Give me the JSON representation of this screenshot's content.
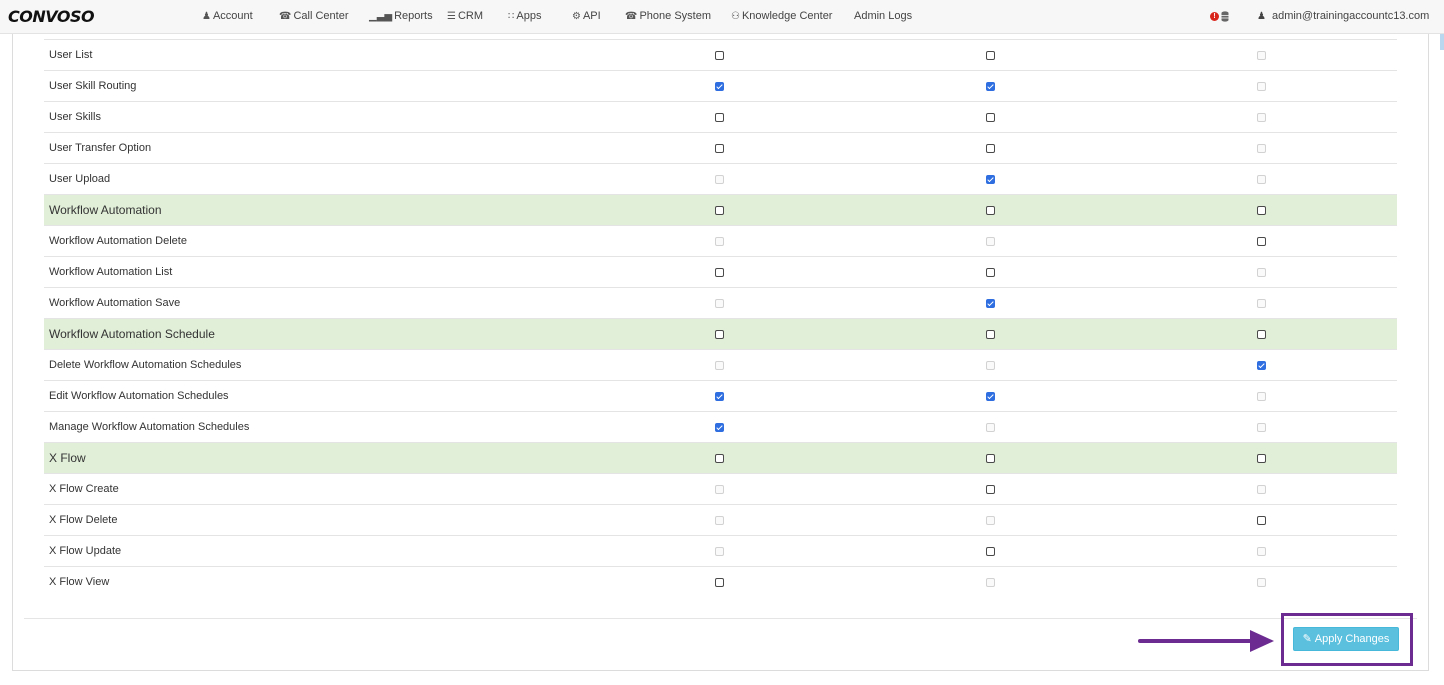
{
  "nav": {
    "logo": "CONVOSO",
    "items": [
      {
        "label": "Account",
        "icon": "user-icon",
        "glyph": "♟"
      },
      {
        "label": "Call Center",
        "icon": "phone-icon",
        "glyph": "☎"
      },
      {
        "label": "Reports",
        "icon": "bar-chart-icon",
        "glyph": "▁▃▅"
      },
      {
        "label": "CRM",
        "icon": "list-icon",
        "glyph": "☰"
      },
      {
        "label": "Apps",
        "icon": "grid-icon",
        "glyph": "∷"
      },
      {
        "label": "API",
        "icon": "gear-icon",
        "glyph": "⚙"
      },
      {
        "label": "Phone System",
        "icon": "phone-icon",
        "glyph": "☎"
      },
      {
        "label": "Knowledge Center",
        "icon": "lightbulb-icon",
        "glyph": "⚇"
      },
      {
        "label": "Admin Logs",
        "icon": "",
        "glyph": ""
      }
    ],
    "alert_glyph": "!",
    "user_email": "admin@trainingaccountc13.com",
    "user_glyph": "♟"
  },
  "rows": [
    {
      "label": "User List",
      "group": false,
      "cells": [
        "off",
        "off",
        "dis"
      ]
    },
    {
      "label": "User Skill Routing",
      "group": false,
      "cells": [
        "on",
        "on",
        "dis"
      ]
    },
    {
      "label": "User Skills",
      "group": false,
      "cells": [
        "off",
        "off",
        "dis"
      ]
    },
    {
      "label": "User Transfer Option",
      "group": false,
      "cells": [
        "off",
        "off",
        "dis"
      ]
    },
    {
      "label": "User Upload",
      "group": false,
      "cells": [
        "dis",
        "on",
        "dis"
      ]
    },
    {
      "label": "Workflow Automation",
      "group": true,
      "cells": [
        "off",
        "off",
        "off"
      ]
    },
    {
      "label": "Workflow Automation Delete",
      "group": false,
      "cells": [
        "dis",
        "dis",
        "off"
      ]
    },
    {
      "label": "Workflow Automation List",
      "group": false,
      "cells": [
        "off",
        "off",
        "dis"
      ]
    },
    {
      "label": "Workflow Automation Save",
      "group": false,
      "cells": [
        "dis",
        "on",
        "dis"
      ]
    },
    {
      "label": "Workflow Automation Schedule",
      "group": true,
      "cells": [
        "off",
        "off",
        "off"
      ]
    },
    {
      "label": "Delete Workflow Automation Schedules",
      "group": false,
      "cells": [
        "dis",
        "dis",
        "on"
      ]
    },
    {
      "label": "Edit Workflow Automation Schedules",
      "group": false,
      "cells": [
        "on",
        "on",
        "dis"
      ]
    },
    {
      "label": "Manage Workflow Automation Schedules",
      "group": false,
      "cells": [
        "on",
        "dis",
        "dis"
      ]
    },
    {
      "label": "X Flow",
      "group": true,
      "cells": [
        "off",
        "off",
        "off"
      ]
    },
    {
      "label": "X Flow Create",
      "group": false,
      "cells": [
        "dis",
        "off",
        "dis"
      ]
    },
    {
      "label": "X Flow Delete",
      "group": false,
      "cells": [
        "dis",
        "dis",
        "off"
      ]
    },
    {
      "label": "X Flow Update",
      "group": false,
      "cells": [
        "dis",
        "off",
        "dis"
      ]
    },
    {
      "label": "X Flow View",
      "group": false,
      "cells": [
        "off",
        "dis",
        "dis"
      ]
    }
  ],
  "actions": {
    "apply_label": "Apply Changes",
    "apply_icon": "edit-icon",
    "apply_glyph": "✎"
  },
  "colors": {
    "group_row": "#e1efd8",
    "checkbox_checked": "#2f6ee0",
    "apply_button": "#5bc0de",
    "annotation": "#6b2b90"
  }
}
